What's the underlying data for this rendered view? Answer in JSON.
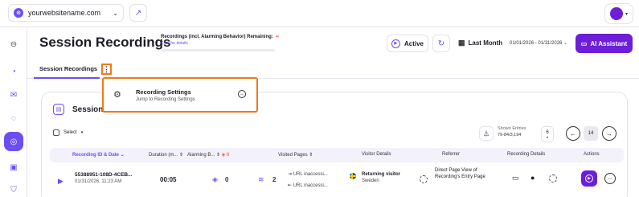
{
  "topbar": {
    "site_name": "yourwebsitename.com",
    "site_icon": "globe-icon",
    "external_icon": "external-link-icon"
  },
  "sidebar": {
    "items": [
      {
        "icon": "collapse-icon"
      },
      {
        "icon": "chart-pie-icon"
      },
      {
        "icon": "inbox-icon"
      },
      {
        "icon": "spiral-icon"
      },
      {
        "icon": "session-recordings-icon",
        "active": true
      },
      {
        "icon": "chat-icon"
      },
      {
        "icon": "shield-icon"
      }
    ]
  },
  "header": {
    "title": "Session Recordings",
    "quota_label": "Recordings (incl. Alarming Behavior) Remaining:",
    "quota_value": "∞",
    "quota_link": "Click for details",
    "active_label": "Active",
    "period_label": "Last Month",
    "date_range": "01/01/2026 - 01/31/2026",
    "ai_label": "AI Assistant"
  },
  "tabs": {
    "active": "Session Recordings",
    "menu_glyph": "⋮"
  },
  "dropdown": {
    "title": "Recording Settings",
    "subtitle": "Jump to Recording Settings"
  },
  "card": {
    "title_visible": "Session R",
    "select_label": "Select",
    "shown_entries_label": "Shown Entries",
    "shown_entries_value": "79-84/3,194",
    "per_page": "6",
    "page": "14"
  },
  "table": {
    "headers": {
      "id": "Recording ID & Date",
      "duration": "Duration (m...",
      "alarming": "Alarming B...",
      "alarming_count": "6",
      "pages": "Visited Pages",
      "visitor": "Visitor Details",
      "referrer": "Referrer",
      "rec_details": "Recording Details",
      "actions": "Actions"
    },
    "rows": [
      {
        "id": "55388951-108D-4CEB...",
        "date": "01/31/2026, 11:23 AM",
        "duration": "00:05",
        "alarming": "0",
        "pages_count": "2",
        "page1": "URL inaccessi...",
        "page2": "URL inaccessi...",
        "visitor_type": "Returning visitor",
        "country": "Sweden",
        "referrer": "Direct Page View of Recording's Entry Page"
      }
    ]
  },
  "colors": {
    "accent": "#6c4df6",
    "ai_button": "#6c1ed8",
    "highlight": "#ee7a1a"
  }
}
